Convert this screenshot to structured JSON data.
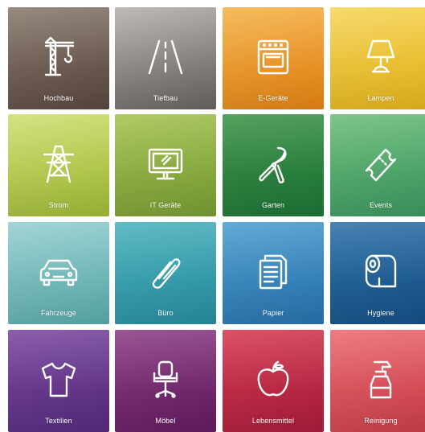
{
  "tiles": [
    {
      "label": "Hochbau",
      "icon": "crane-icon",
      "colors": [
        "#8a7a6c",
        "#5e4c44"
      ]
    },
    {
      "label": "Tiefbau",
      "icon": "road-icon",
      "colors": [
        "#b7b1ad",
        "#6f6865"
      ]
    },
    {
      "label": "E-Geräte",
      "icon": "oven-icon",
      "colors": [
        "#f4b34a",
        "#f28a14"
      ]
    },
    {
      "label": "Lampen",
      "icon": "lamp-icon",
      "colors": [
        "#f6d45a",
        "#f3bf1a"
      ]
    },
    {
      "label": "Strom",
      "icon": "power-pylon-icon",
      "colors": [
        "#cfdf71",
        "#a9c53a"
      ]
    },
    {
      "label": "IT Geräte",
      "icon": "monitor-icon",
      "colors": [
        "#a6c24f",
        "#7ea637"
      ]
    },
    {
      "label": "Garten",
      "icon": "pruning-shears-icon",
      "colors": [
        "#3e9448",
        "#1f7a3a"
      ]
    },
    {
      "label": "Events",
      "icon": "ticket-icon",
      "colors": [
        "#6cbd7a",
        "#3f9f66"
      ]
    },
    {
      "label": "Fahrzeuge",
      "icon": "car-icon",
      "colors": [
        "#96cfd0",
        "#5fb4b5"
      ]
    },
    {
      "label": "Büro",
      "icon": "paperclip-icon",
      "colors": [
        "#4ab3bd",
        "#2a95a8"
      ]
    },
    {
      "label": "Papier",
      "icon": "documents-icon",
      "colors": [
        "#4d9fd0",
        "#2a78b7"
      ]
    },
    {
      "label": "Hygiene",
      "icon": "toilet-paper-icon",
      "colors": [
        "#2d72a8",
        "#17548d"
      ]
    },
    {
      "label": "Textilien",
      "icon": "tshirt-icon",
      "colors": [
        "#7a48a0",
        "#5b2d86"
      ]
    },
    {
      "label": "Möbel",
      "icon": "office-chair-icon",
      "colors": [
        "#8c3e86",
        "#6a1d66"
      ]
    },
    {
      "label": "Lebensmittel",
      "icon": "apple-icon",
      "colors": [
        "#d63a52",
        "#b31e3f"
      ]
    },
    {
      "label": "Reinigung",
      "icon": "spray-bottle-icon",
      "colors": [
        "#ec6a70",
        "#d6424f"
      ]
    }
  ]
}
